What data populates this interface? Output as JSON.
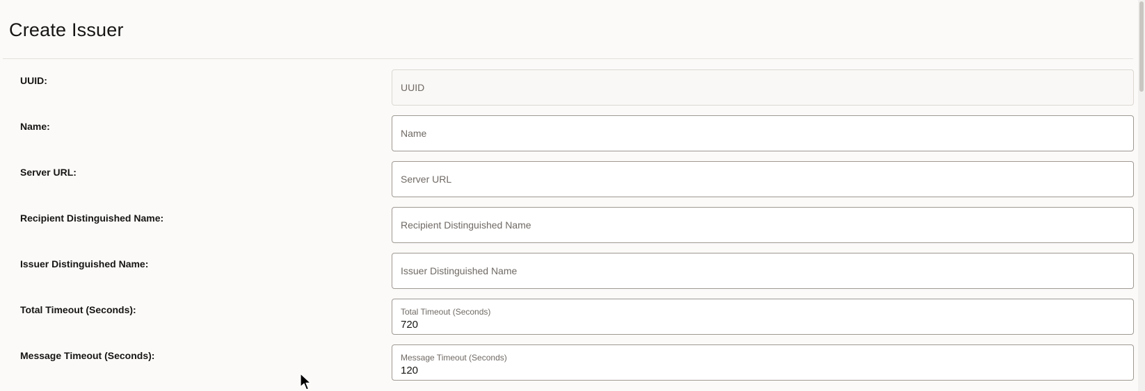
{
  "page": {
    "title": "Create Issuer"
  },
  "form": {
    "uuid": {
      "label": "UUID:",
      "placeholder": "UUID",
      "value": ""
    },
    "name": {
      "label": "Name:",
      "placeholder": "Name",
      "value": ""
    },
    "server_url": {
      "label": "Server URL:",
      "placeholder": "Server URL",
      "value": ""
    },
    "recipient_dn": {
      "label": "Recipient Distinguished Name:",
      "placeholder": "Recipient Distinguished Name",
      "value": ""
    },
    "issuer_dn": {
      "label": "Issuer Distinguished Name:",
      "placeholder": "Issuer Distinguished Name",
      "value": ""
    },
    "total_timeout": {
      "label": "Total Timeout (Seconds):",
      "inner_label": "Total Timeout (Seconds)",
      "value": "720"
    },
    "message_timeout": {
      "label": "Message Timeout (Seconds):",
      "inner_label": "Message Timeout (Seconds)",
      "value": "120"
    }
  },
  "colors": {
    "background": "#fbfaf8",
    "field_border": "#9e9892",
    "readonly_border": "#dcd8d3",
    "text": "#161513",
    "placeholder": "#6f6964"
  },
  "icons": {
    "cursor": "mouse-pointer-icon"
  }
}
